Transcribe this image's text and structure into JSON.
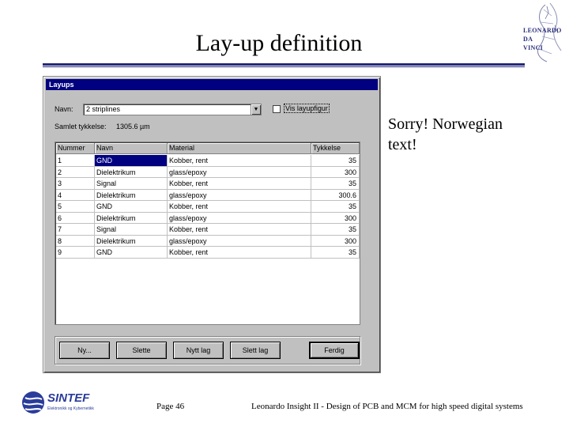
{
  "slide": {
    "title": "Lay-up definition",
    "side_text": "Sorry! Norwegian text!",
    "footer_page": "Page 46",
    "footer_caption": "Leonardo Insight II - Design of PCB and MCM for high speed digital systems"
  },
  "logos": {
    "leonardo_lines": [
      "LEONARDO",
      "DA",
      "VINCI"
    ],
    "sintef_name": "SINTEF",
    "sintef_sub": "Elektronikk og Kybernetikk"
  },
  "dialog": {
    "title": "Layups",
    "name_label": "Navn:",
    "name_value": "2 striplines",
    "checkbox_label": "Vis layupfigur",
    "checkbox_checked": false,
    "total_label": "Samlet tykkelse:",
    "total_value": "1305.6",
    "total_unit": "µm",
    "columns": [
      "Nummer",
      "Navn",
      "Material",
      "Tykkelse"
    ],
    "rows": [
      [
        "1",
        "GND",
        "Kobber, rent",
        "35"
      ],
      [
        "2",
        "Dielektrikum",
        "glass/epoxy",
        "300"
      ],
      [
        "3",
        "Signal",
        "Kobber, rent",
        "35"
      ],
      [
        "4",
        "Dielektrikum",
        "glass/epoxy",
        "300.6"
      ],
      [
        "5",
        "GND",
        "Kobber, rent",
        "35"
      ],
      [
        "6",
        "Dielektrikum",
        "glass/epoxy",
        "300"
      ],
      [
        "7",
        "Signal",
        "Kobber, rent",
        "35"
      ],
      [
        "8",
        "Dielektrikum",
        "glass/epoxy",
        "300"
      ],
      [
        "9",
        "GND",
        "Kobber, rent",
        "35"
      ]
    ],
    "selected_row": 0,
    "buttons": {
      "new": "Ny...",
      "delete": "Slette",
      "new_layer": "Nytt lag",
      "delete_layer": "Slett lag",
      "done": "Ferdig"
    }
  },
  "colors": {
    "accent_rule": "#24287a",
    "titlebar": "#000080",
    "selection": "#000080"
  }
}
